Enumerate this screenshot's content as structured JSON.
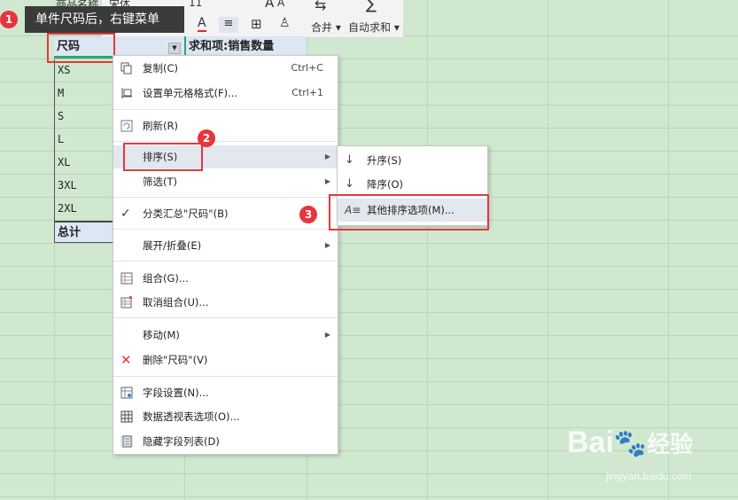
{
  "toolbar": {
    "field_name": "商品名称",
    "font_name": "宋体",
    "font_size": "11",
    "merge_label": "合并",
    "autosum_label": "自动求和"
  },
  "callout": {
    "badge": "1",
    "text": "单件尺码后，右键菜单"
  },
  "pivot": {
    "row_header": "尺码",
    "value_header": "求和项:销售数量",
    "rows": [
      "XS",
      "M",
      "S",
      "L",
      "XL",
      "3XL",
      "2XL"
    ],
    "total_label": "总计"
  },
  "context_menu": {
    "items": [
      {
        "label": "复制(C)",
        "shortcut": "Ctrl+C",
        "icon": "copy-icon"
      },
      {
        "label": "设置单元格格式(F)...",
        "shortcut": "Ctrl+1",
        "icon": "format-cells-icon"
      },
      {
        "label": "刷新(R)",
        "icon": "refresh-icon"
      },
      {
        "label": "排序(S)",
        "submenu": true
      },
      {
        "label": "筛选(T)",
        "submenu": true
      },
      {
        "label": "分类汇总\"尺码\"(B)",
        "icon": "check-icon"
      },
      {
        "label": "展开/折叠(E)",
        "submenu": true
      },
      {
        "label": "组合(G)...",
        "icon": "group-icon"
      },
      {
        "label": "取消组合(U)...",
        "icon": "ungroup-icon"
      },
      {
        "label": "移动(M)",
        "submenu": true
      },
      {
        "label": "删除\"尺码\"(V)",
        "icon": "delete-x-icon"
      },
      {
        "label": "字段设置(N)...",
        "icon": "field-settings-icon"
      },
      {
        "label": "数据透视表选项(O)...",
        "icon": "pivot-options-icon"
      },
      {
        "label": "隐藏字段列表(D)",
        "icon": "field-list-icon"
      }
    ]
  },
  "sort_submenu": {
    "items": [
      {
        "label": "升序(S)",
        "icon": "sort-ascending-icon"
      },
      {
        "label": "降序(O)",
        "icon": "sort-descending-icon"
      },
      {
        "label": "其他排序选项(M)...",
        "icon": "more-sort-options-icon"
      }
    ]
  },
  "badges": {
    "step2": "2",
    "step3": "3"
  },
  "watermark": {
    "brand": "Bai",
    "brand2": "经验",
    "url": "jingyan.baidu.com"
  },
  "colors": {
    "sheet_bg": "#cfe8cf",
    "annotation_red": "#e3393e",
    "menu_highlight": "#e3e7ee"
  }
}
